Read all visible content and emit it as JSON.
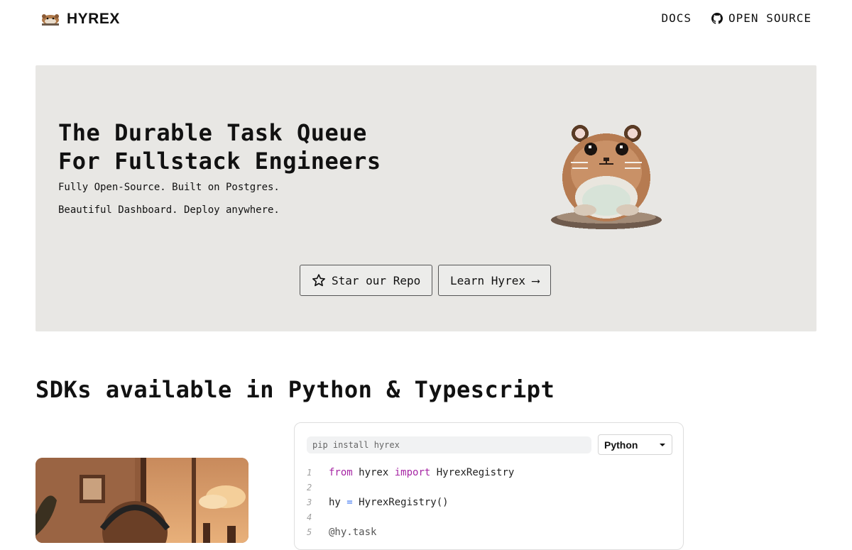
{
  "header": {
    "logo_text": "HYREX",
    "nav": [
      {
        "label": "DOCS",
        "icon": null
      },
      {
        "label": "OPEN SOURCE",
        "icon": "github-icon"
      }
    ]
  },
  "hero": {
    "title_line1": "The Durable Task Queue",
    "title_line2": "For Fullstack Engineers",
    "subtitle_line1": "Fully Open-Source. Built on Postgres.",
    "subtitle_line2": "Beautiful Dashboard. Deploy anywhere.",
    "star_button": "Star our Repo",
    "learn_button": "Learn Hyrex ⟶",
    "mascot_icon": "hamster-mascot-icon"
  },
  "sdk_section": {
    "title": "SDKs available in Python & Typescript",
    "install_command": "pip install hyrex",
    "language_selected": "Python",
    "code_lines": [
      {
        "num": "1",
        "tokens": [
          {
            "t": "from",
            "c": "kw"
          },
          {
            "t": " hyrex ",
            "c": ""
          },
          {
            "t": "import",
            "c": "kw"
          },
          {
            "t": " HyrexRegistry",
            "c": ""
          }
        ]
      },
      {
        "num": "2",
        "tokens": []
      },
      {
        "num": "3",
        "tokens": [
          {
            "t": "hy ",
            "c": ""
          },
          {
            "t": "=",
            "c": "op"
          },
          {
            "t": " HyrexRegistry()",
            "c": ""
          }
        ]
      },
      {
        "num": "4",
        "tokens": []
      },
      {
        "num": "5",
        "tokens": [
          {
            "t": "@hy.task",
            "c": "dec"
          }
        ]
      }
    ]
  },
  "colors": {
    "hero_bg": "#e8e7e4",
    "keyword": "#a626a4",
    "operator": "#4078f2"
  }
}
